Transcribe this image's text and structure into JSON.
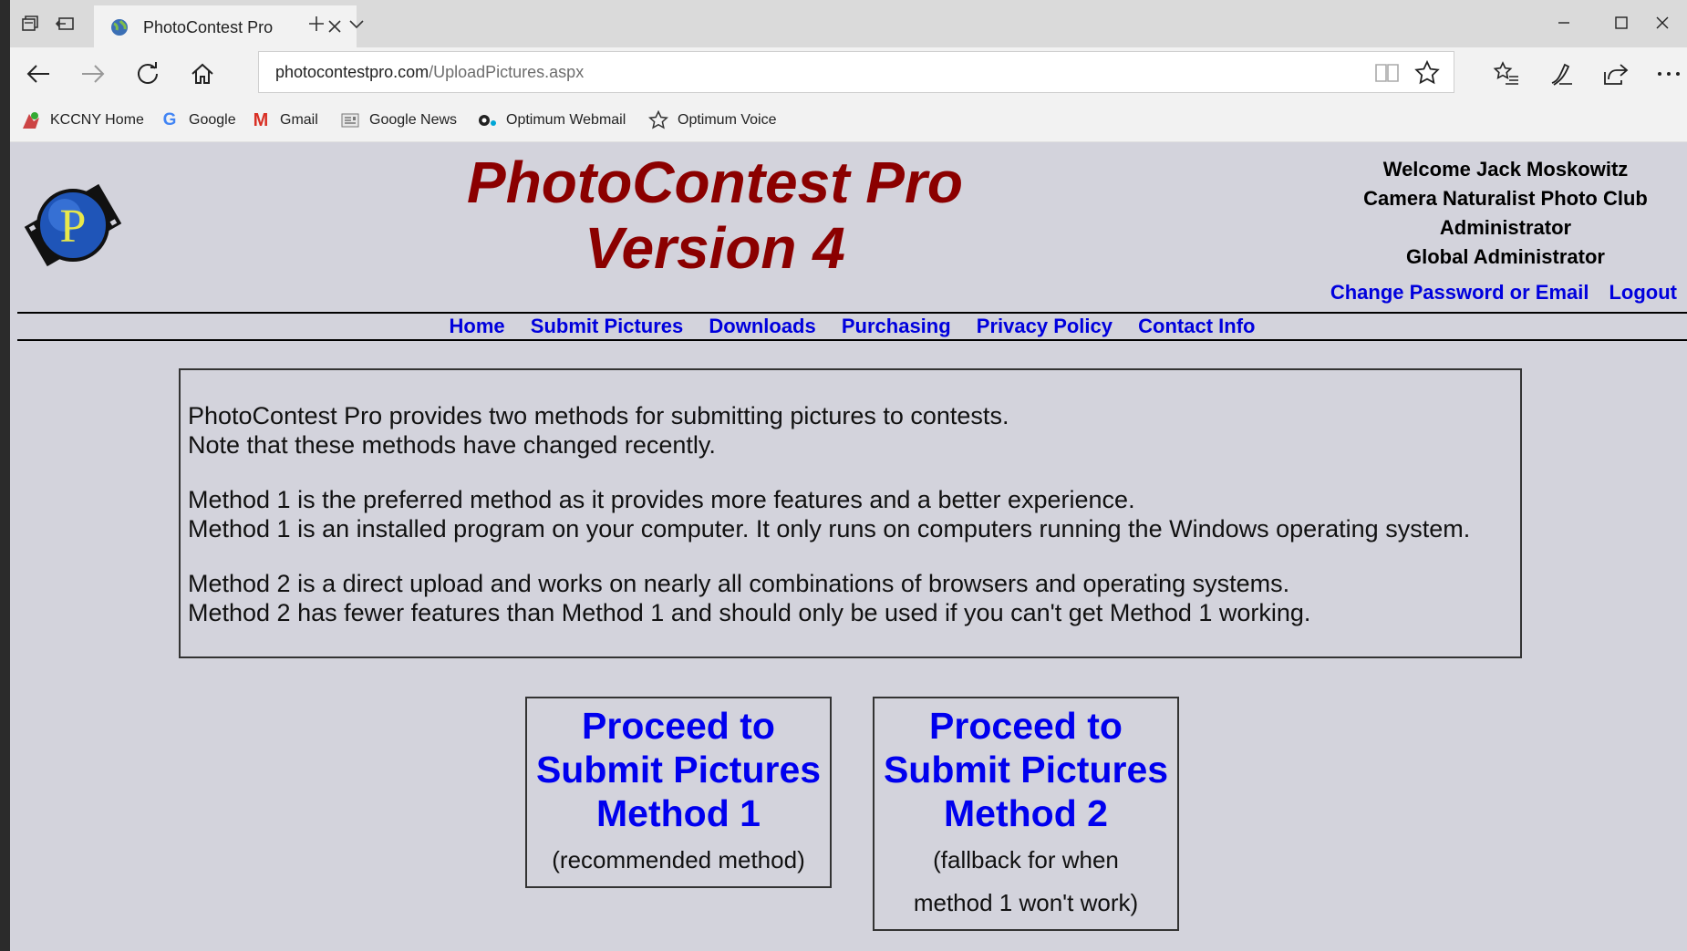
{
  "browser": {
    "tab_title": "PhotoContest Pro",
    "url_domain": "photocontestpro.com",
    "url_path": "/UploadPictures.aspx",
    "favorites": [
      {
        "label": "KCCNY Home",
        "icon": "kccny-favicon"
      },
      {
        "label": "Google",
        "icon": "google-g-icon"
      },
      {
        "label": "Gmail",
        "icon": "gmail-m-icon"
      },
      {
        "label": "Google News",
        "icon": "news-icon"
      },
      {
        "label": "Optimum Webmail",
        "icon": "optimum-icon"
      },
      {
        "label": "Optimum Voice",
        "icon": "star-outline-icon"
      }
    ]
  },
  "site": {
    "title_line1": "PhotoContest Pro",
    "title_line2": "Version 4",
    "title_color": "#8b0000",
    "link_color": "#0000dd",
    "background": "#d3d3dc"
  },
  "user": {
    "welcome": "Welcome Jack Moskowitz",
    "club": "Camera Naturalist Photo Club",
    "role1": "Administrator",
    "role2": "Global Administrator",
    "change_link": "Change Password or Email",
    "logout_link": "Logout"
  },
  "menu": [
    "Home",
    "Submit Pictures",
    "Downloads",
    "Purchasing",
    "Privacy Policy",
    "Contact Info"
  ],
  "notice": {
    "p1_line1": "PhotoContest Pro provides two methods for submitting pictures to contests.",
    "p1_line2": "Note that these methods have changed recently.",
    "p2_line1": "Method 1 is the preferred method as it provides more features and a better experience.",
    "p2_line2": "Method 1 is an installed program on your computer. It only runs on computers running the Windows operating system.",
    "p3_line1": "Method 2 is a direct upload and works on nearly all combinations of browsers and operating systems.",
    "p3_line2": "Method 2 has fewer features than Method 1 and should only be used if you can't get Method 1 working."
  },
  "methods": [
    {
      "line1": "Proceed to",
      "line2": "Submit Pictures",
      "line3": "Method 1",
      "note1": "(recommended method)",
      "note2": ""
    },
    {
      "line1": "Proceed to",
      "line2": "Submit Pictures",
      "line3": "Method 2",
      "note1": "(fallback for when",
      "note2": "method 1 won't work)"
    }
  ]
}
